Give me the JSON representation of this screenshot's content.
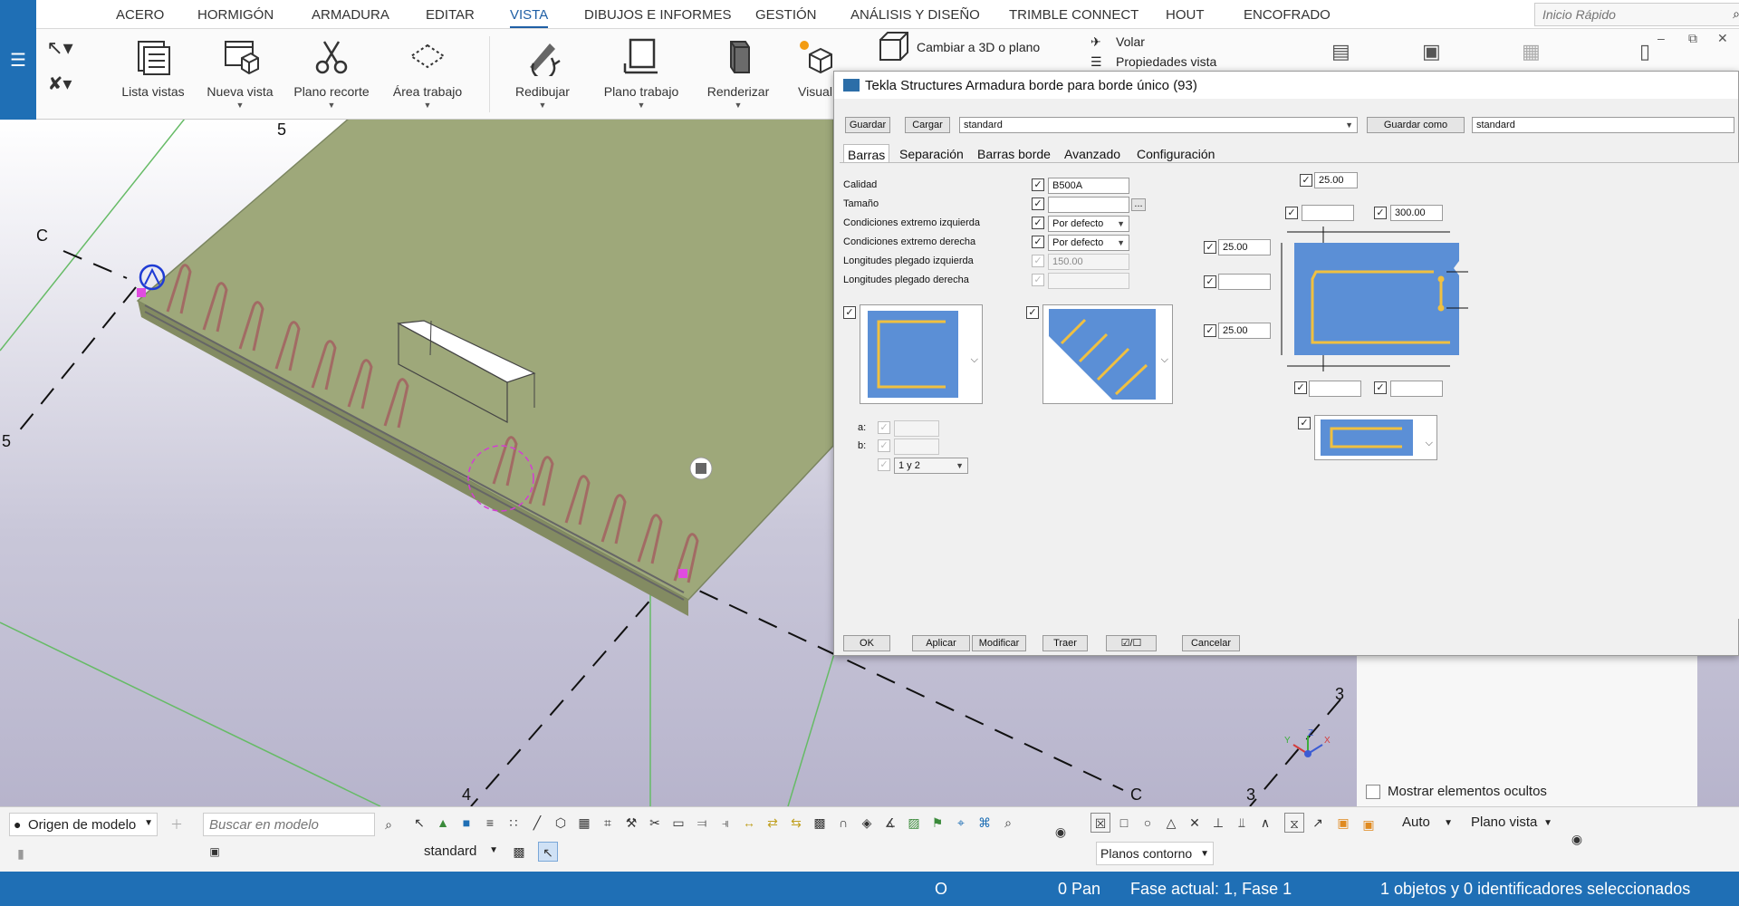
{
  "ribbon": {
    "menu": [
      "ACERO",
      "HORMIGÓN",
      "ARMADURA",
      "EDITAR",
      "VISTA",
      "DIBUJOS E INFORMES",
      "GESTIÓN",
      "ANÁLISIS Y DISEÑO",
      "TRIMBLE CONNECT",
      "HOUT",
      "ENCOFRADO"
    ],
    "active_menu": "VISTA",
    "quick_launch_placeholder": "Inicio Rápido",
    "buttons": [
      "Lista vistas",
      "Nueva vista",
      "Plano recorte",
      "Área trabajo",
      "Redibujar",
      "Plano trabajo",
      "Renderizar",
      "Visual"
    ],
    "small_buttons": [
      "Cambiar a 3D o plano",
      "Volar",
      "Propiedades vista"
    ]
  },
  "viewport": {
    "grid_labels": [
      "5",
      "C",
      "5",
      "4",
      "C",
      "3",
      "3"
    ],
    "axis_letters": [
      "Y",
      "Z",
      "X"
    ]
  },
  "dialog": {
    "title": "Tekla Structures  Armadura borde para borde único (93)",
    "save_label": "Guardar",
    "load_label": "Cargar",
    "preset_value": "standard",
    "save_as_label": "Guardar como",
    "save_as_value": "standard",
    "tabs": [
      "Barras",
      "Separación",
      "Barras borde",
      "Avanzado",
      "Configuración"
    ],
    "active_tab": "Barras",
    "fields": [
      {
        "label": "Calidad",
        "value": "B500A"
      },
      {
        "label": "Tamaño",
        "value": ""
      },
      {
        "label": "Condiciones extremo izquierda",
        "value": "Por defecto"
      },
      {
        "label": "Condiciones extremo derecha",
        "value": "Por defecto"
      },
      {
        "label": "Longitudes plegado izquierda",
        "value": "150.00"
      },
      {
        "label": "Longitudes plegado derecha",
        "value": ""
      }
    ],
    "browse_label": "...",
    "dims": {
      "top": "25.00",
      "width": "300.00",
      "left_top": "25.00",
      "left_bottom": "25.00"
    },
    "ab": {
      "a_label": "a:",
      "b_label": "b:",
      "sel_value": "1 y 2"
    },
    "footer": {
      "ok": "OK",
      "apply": "Aplicar",
      "modify": "Modificar",
      "get": "Traer",
      "toggle": "☑/☐",
      "cancel": "Cancelar"
    }
  },
  "bottom": {
    "origin_label": "Origen de modelo",
    "search_placeholder": "Buscar en modelo",
    "filter_value": "standard",
    "snap_auto": "Auto",
    "snap_plane": "Plano vista",
    "contour_planes": "Planos contorno",
    "show_hidden": "Mostrar elementos ocultos"
  },
  "status": {
    "o": "O",
    "pan": "0  Pan",
    "phase": "Fase actual: 1, Fase 1",
    "selection": "1 objetos y 0 identificadores seleccionados"
  },
  "colors": {
    "accent": "#1f6fb5",
    "slab": "#9ea87a",
    "rebar": "#a26b64",
    "diagram_blue": "#5b8fd6",
    "bar_yellow": "#f0c040"
  }
}
